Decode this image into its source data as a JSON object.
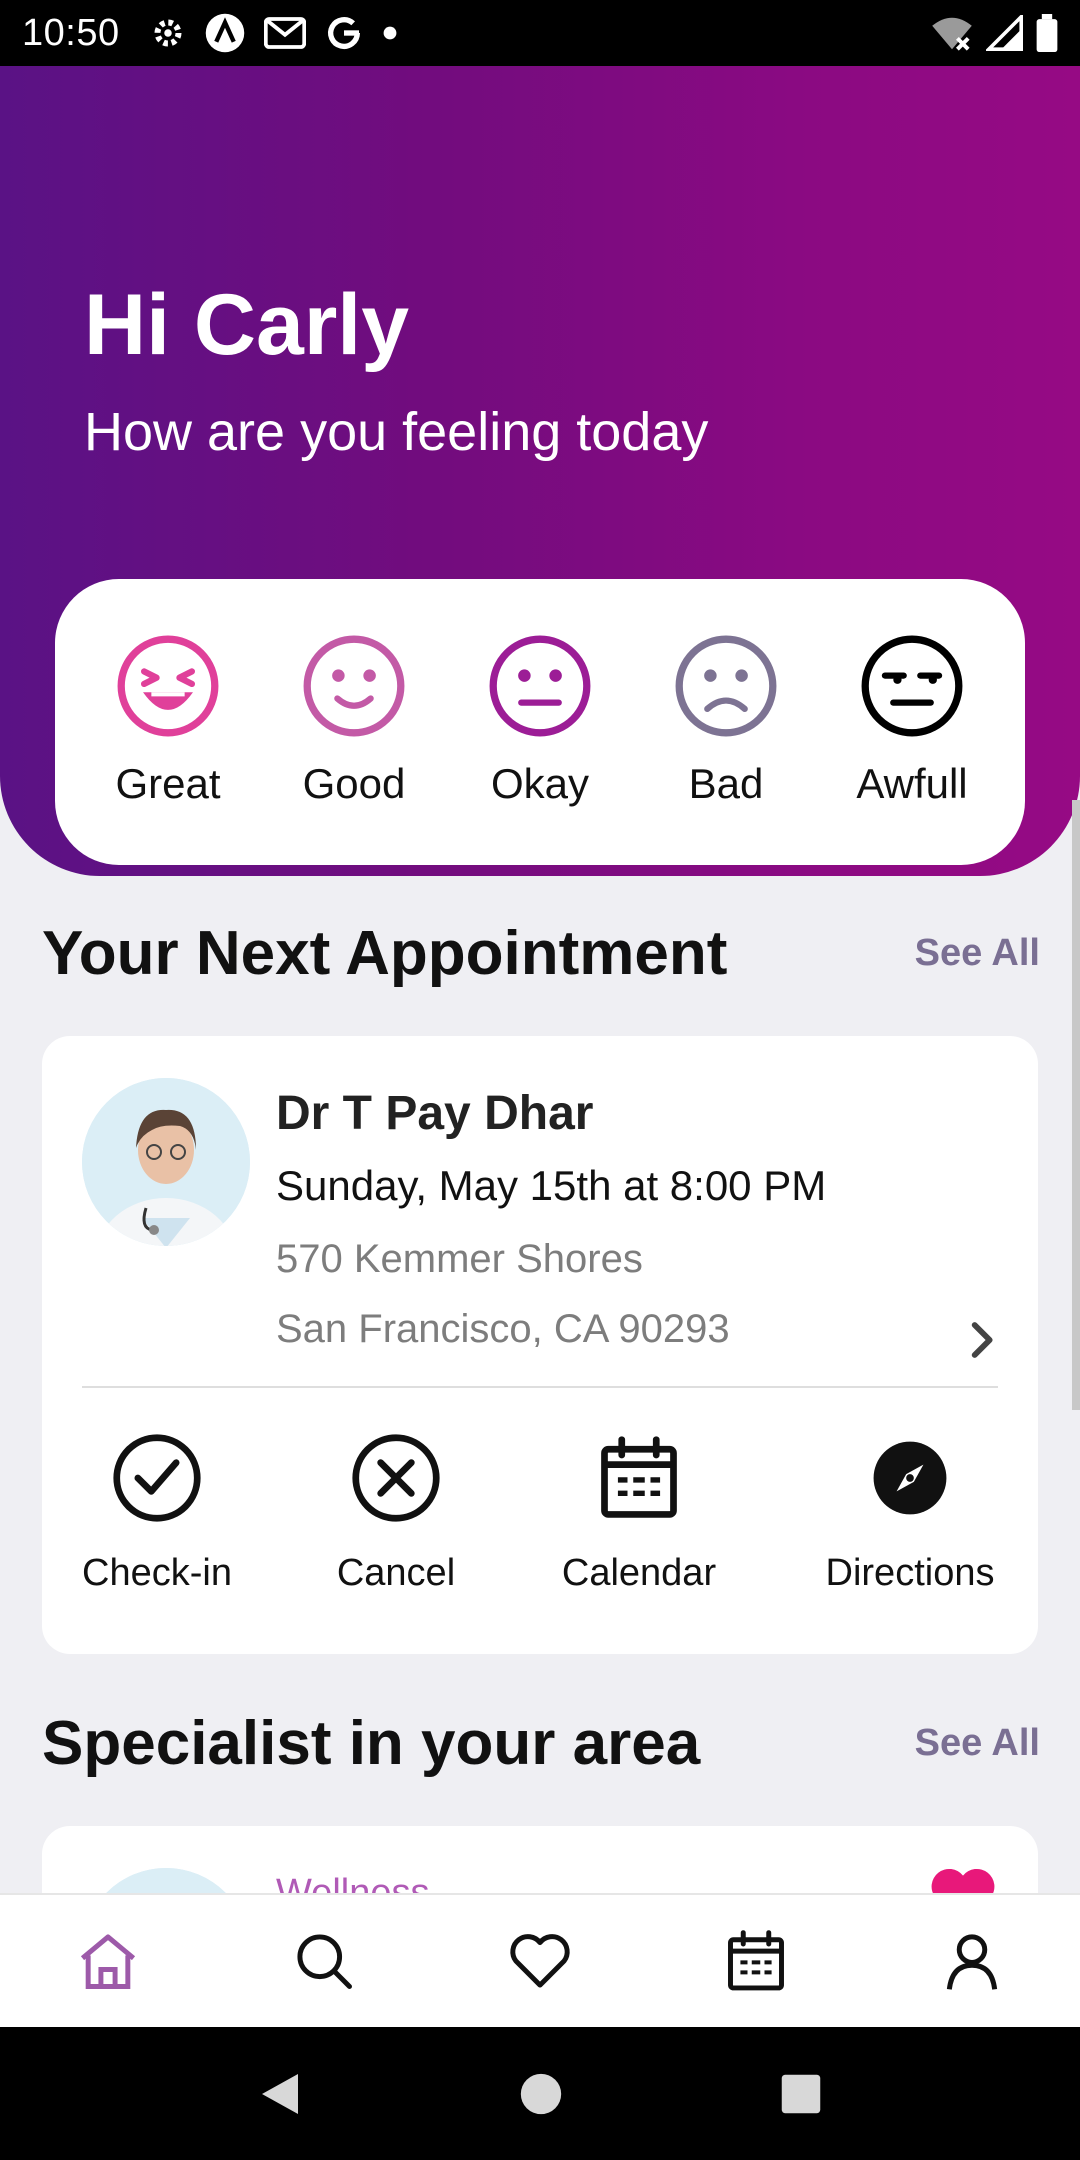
{
  "status": {
    "time": "10:50",
    "icons": [
      "settings-icon",
      "avast-icon",
      "gmail-icon",
      "google-icon",
      "dot-icon"
    ],
    "right_icons": [
      "wifi-off-icon",
      "signal-icon",
      "battery-icon"
    ]
  },
  "header": {
    "greeting": "Hi Carly",
    "subtitle": "How are you feeling today"
  },
  "moods": [
    {
      "label": "Great",
      "icon": "great-face-icon",
      "color": "#e0409a"
    },
    {
      "label": "Good",
      "icon": "good-face-icon",
      "color": "#c35aa6"
    },
    {
      "label": "Okay",
      "icon": "okay-face-icon",
      "color": "#9c1d96"
    },
    {
      "label": "Bad",
      "icon": "bad-face-icon",
      "color": "#7d7393"
    },
    {
      "label": "Awfull",
      "icon": "awful-face-icon",
      "color": "#000000"
    }
  ],
  "appointment_section": {
    "title": "Your Next Appointment",
    "see_all": "See All"
  },
  "appointment": {
    "doctor": "Dr T Pay Dhar",
    "datetime": "Sunday, May 15th at 8:00 PM",
    "address_line1": "570 Kemmer Shores",
    "address_line2": "San Francisco, CA 90293",
    "actions": [
      {
        "label": "Check-in",
        "icon": "check-circle-icon"
      },
      {
        "label": "Cancel",
        "icon": "cancel-circle-icon"
      },
      {
        "label": "Calendar",
        "icon": "calendar-icon"
      },
      {
        "label": "Directions",
        "icon": "compass-icon"
      }
    ]
  },
  "specialist_section": {
    "title": "Specialist in your area",
    "see_all": "See All",
    "first_category": "Wellness"
  },
  "bottom_nav": [
    "home-icon",
    "search-icon",
    "heart-icon",
    "calendar-icon",
    "profile-icon"
  ],
  "colors": {
    "accent": "#8b0a82",
    "see_all": "#7a6f93",
    "active_nav": "#9d5aa9",
    "heart": "#e8187a"
  }
}
